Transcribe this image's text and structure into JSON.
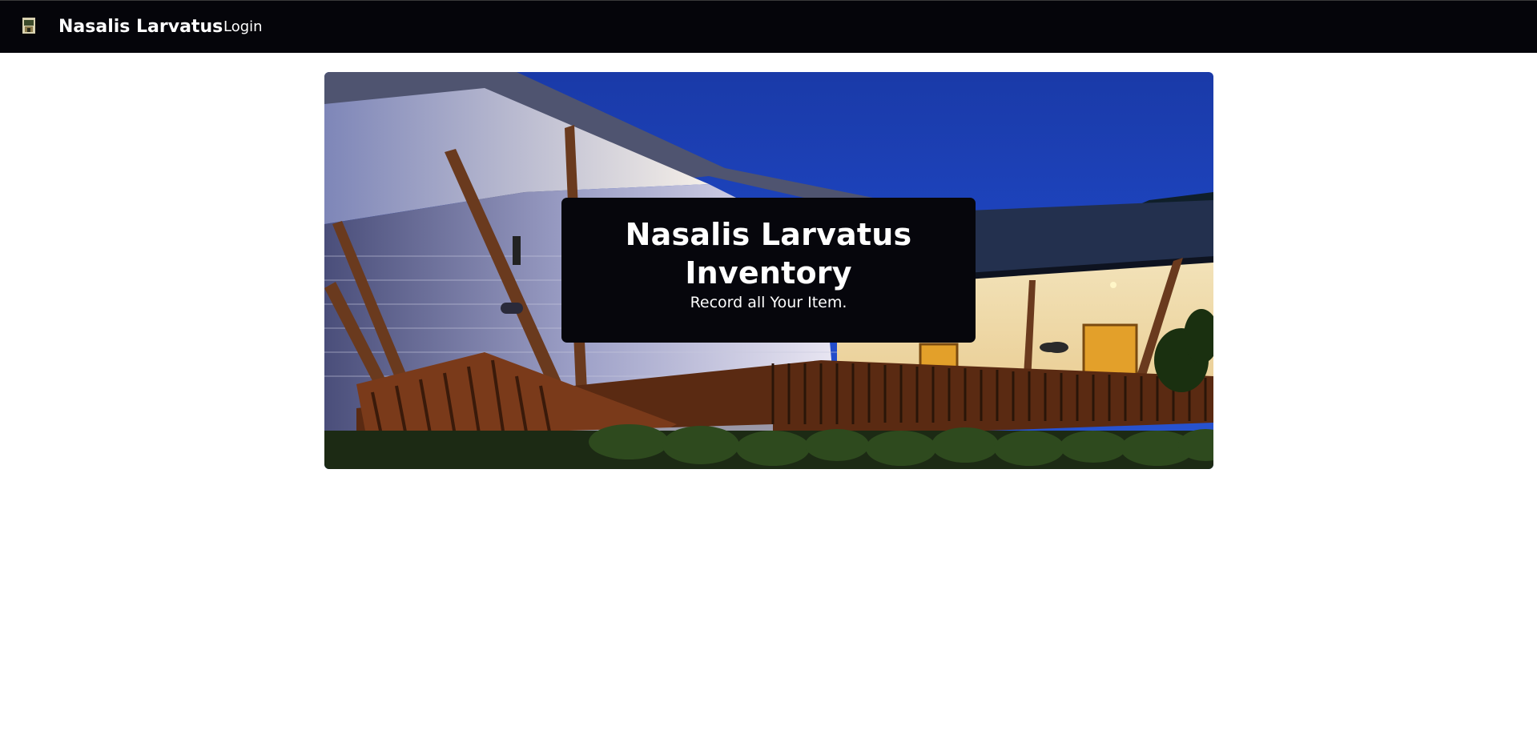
{
  "navbar": {
    "logo_icon": "house-logo-icon",
    "brand": "Nasalis Larvatus",
    "links": [
      {
        "label": "Login"
      }
    ]
  },
  "hero": {
    "image": "lodge-building-at-dusk-photo",
    "title": "Nasalis Larvatus Inventory",
    "subtitle": "Record all Your Item."
  }
}
